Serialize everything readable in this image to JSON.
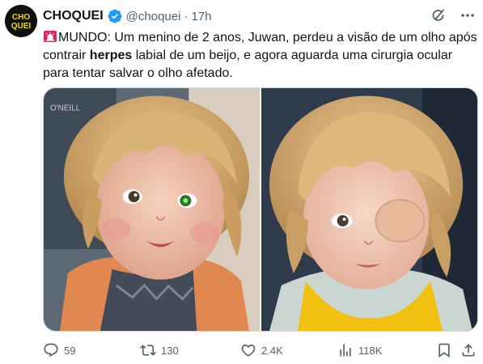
{
  "post": {
    "author_name": "CHOQUEI",
    "author_handle": "@choquei",
    "separator": "·",
    "time": "17h",
    "avatar_text_top": "CHO",
    "avatar_text_bottom": "QUEI",
    "text_prefix": "MUNDO: Um menino de 2 anos, Juwan, perdeu a visão de um olho após contrair ",
    "text_bold": "herpes",
    "text_suffix": " labial de um beijo, e agora aguarda uma cirurgia ocular para tentar salvar o olho afetado.",
    "media": [
      "photo-1",
      "photo-2"
    ]
  },
  "actions": {
    "reply_count": "59",
    "retweet_count": "130",
    "like_count": "2.4K",
    "views_count": "118K"
  },
  "icons": {
    "verified": "verified-badge-icon",
    "grok": "grok-icon",
    "more": "more-icon",
    "siren": "rotating-light-icon",
    "reply": "reply-icon",
    "retweet": "retweet-icon",
    "like": "heart-icon",
    "views": "views-icon",
    "bookmark": "bookmark-icon",
    "share": "share-icon"
  },
  "colors": {
    "text": "#0f1419",
    "muted": "#536471",
    "verified": "#1d9bf0",
    "avatar_bg": "#0f0f0f",
    "avatar_text": "#f5d90a",
    "siren": "#e0245e"
  }
}
